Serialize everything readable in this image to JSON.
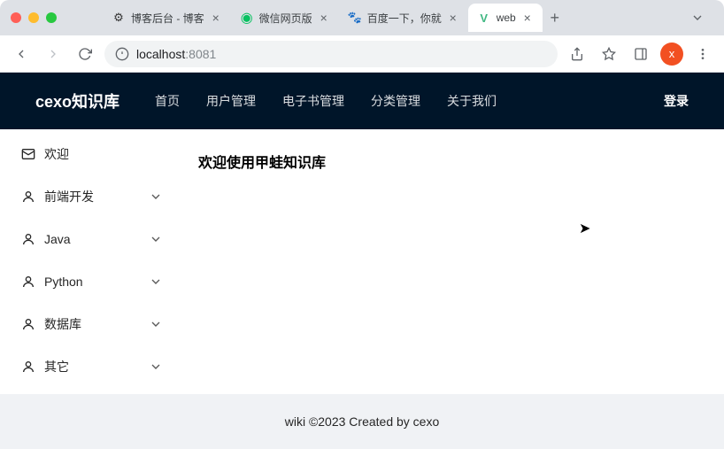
{
  "browser": {
    "tabs": [
      {
        "title": "博客后台 - 博客",
        "favicon": "✦"
      },
      {
        "title": "微信网页版",
        "favicon": "●"
      },
      {
        "title": "百度一下，你就",
        "favicon": "🐾"
      },
      {
        "title": "web",
        "favicon": "V"
      }
    ],
    "url_host": "localhost",
    "url_port": ":8081",
    "avatar_letter": "x"
  },
  "header": {
    "logo": "cexo知识库",
    "menu": [
      "首页",
      "用户管理",
      "电子书管理",
      "分类管理",
      "关于我们"
    ],
    "login": "登录"
  },
  "sidebar": {
    "items": [
      {
        "label": "欢迎",
        "icon": "mail",
        "expandable": false
      },
      {
        "label": "前端开发",
        "icon": "user",
        "expandable": true
      },
      {
        "label": "Java",
        "icon": "user",
        "expandable": true
      },
      {
        "label": "Python",
        "icon": "user",
        "expandable": true
      },
      {
        "label": "数据库",
        "icon": "user",
        "expandable": true
      },
      {
        "label": "其它",
        "icon": "user",
        "expandable": true
      }
    ]
  },
  "main": {
    "welcome": "欢迎使用甲蛙知识库"
  },
  "footer": {
    "text": "wiki ©2023 Created by cexo"
  }
}
